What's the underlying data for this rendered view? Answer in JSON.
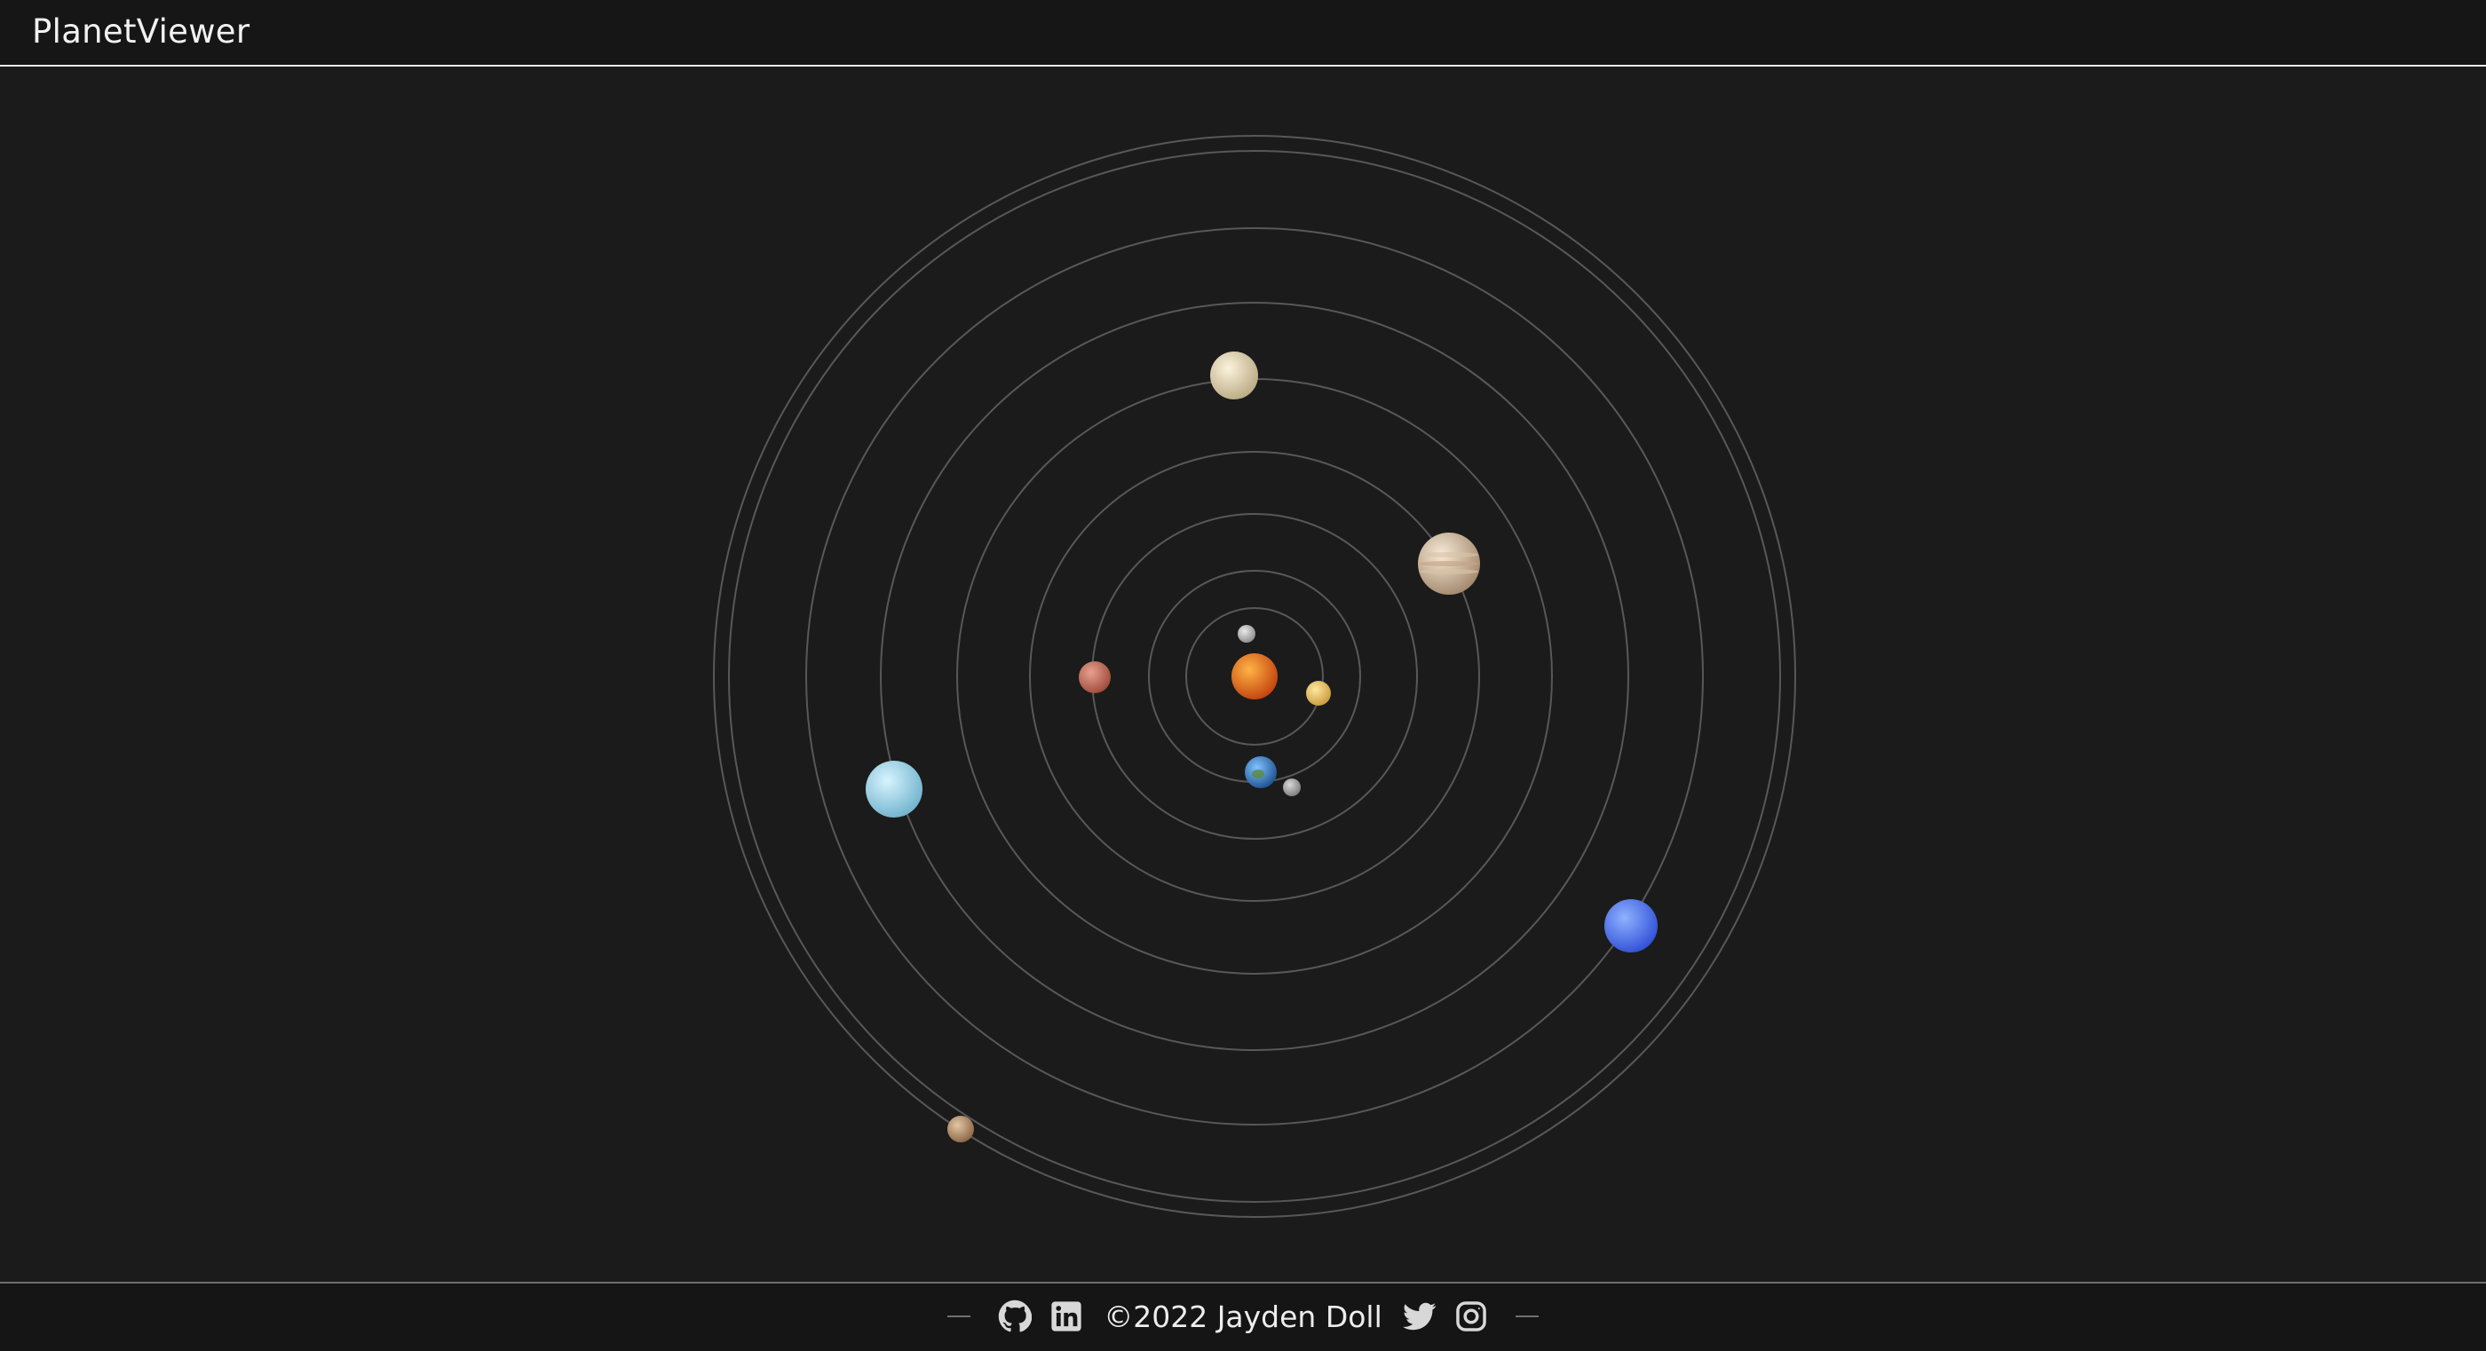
{
  "app": {
    "brand": "PlanetViewer"
  },
  "footer": {
    "copyright": "©2022 Jayden Doll",
    "icons": [
      "github-icon",
      "linkedin-icon",
      "twitter-icon",
      "instagram-icon"
    ]
  },
  "colors": {
    "header_bg": "#161616",
    "stage_bg": "#1b1b1b",
    "orbit": "#8a8a8a",
    "icon": "#d8d8d8"
  },
  "solar_system": {
    "orbit_count": 9,
    "bodies": [
      {
        "name": "sun",
        "color_light": "#ffb347",
        "color_dark": "#c2410c"
      },
      {
        "name": "mercury",
        "color_light": "#e9e9e9",
        "color_dark": "#8a8a8a"
      },
      {
        "name": "venus",
        "color_light": "#ffe7a0",
        "color_dark": "#c99a3b"
      },
      {
        "name": "earth",
        "color_light": "#7fc3ff",
        "color_dark": "#1f4f8f"
      },
      {
        "name": "moon",
        "color_light": "#d8d8d8",
        "color_dark": "#7a7a7a"
      },
      {
        "name": "mars",
        "color_light": "#e9a08f",
        "color_dark": "#9c4a3a"
      },
      {
        "name": "jupiter",
        "color_light": "#f6ead8",
        "color_dark": "#a2876b"
      },
      {
        "name": "saturn",
        "color_light": "#fbf3dc",
        "color_dark": "#b9a983"
      },
      {
        "name": "uranus",
        "color_light": "#d8f4ff",
        "color_dark": "#6fb2cc"
      },
      {
        "name": "neptune",
        "color_light": "#8fb2ff",
        "color_dark": "#2f4fd6"
      },
      {
        "name": "pluto",
        "color_light": "#e3c6a5",
        "color_dark": "#8a6443"
      }
    ]
  }
}
